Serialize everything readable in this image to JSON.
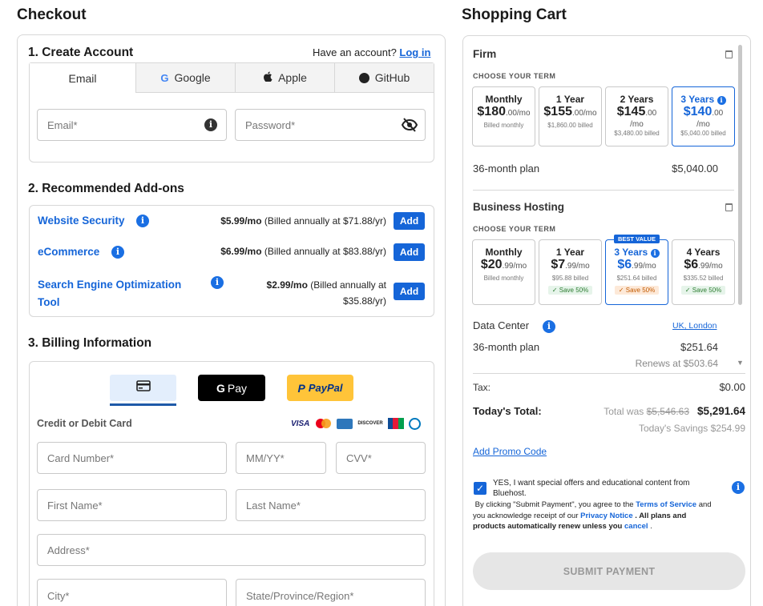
{
  "checkout": {
    "title": "Checkout",
    "create_account": {
      "title": "1. Create Account",
      "have_account_text": "Have an account?",
      "login_link": "Log in",
      "tabs": [
        "Email",
        "Google",
        "Apple",
        "GitHub"
      ],
      "email_placeholder": "Email*",
      "password_placeholder": "Password*"
    },
    "addons": {
      "title": "2. Recommended Add-ons",
      "items": [
        {
          "name": "Website Security",
          "price": "$5.99/mo",
          "billed": "(Billed annually at $71.88/yr)",
          "button": "Add"
        },
        {
          "name": "eCommerce",
          "price": "$6.99/mo",
          "billed": "(Billed annually at $83.88/yr)",
          "button": "Add"
        },
        {
          "name_line1": "Search Engine Optimization",
          "name_line2": "Tool",
          "price": "$2.99/mo",
          "billed_line1": "(Billed annually at",
          "billed_line2": "$35.88/yr)",
          "button": "Add"
        }
      ]
    },
    "billing": {
      "title": "3. Billing Information",
      "methods": {
        "card_icon": "credit-card-icon",
        "gpay": "Pay",
        "paypal": "PayPal"
      },
      "card_label": "Credit or Debit Card",
      "card_brands": [
        "VISA",
        "mastercard",
        "AMEX",
        "DISCOVER",
        "JCB",
        "diners"
      ],
      "placeholders": {
        "card_number": "Card Number*",
        "expiry": "MM/YY*",
        "cvv": "CVV*",
        "first_name": "First Name*",
        "last_name": "Last Name*",
        "address": "Address*",
        "city": "City*",
        "state": "State/Province/Region*"
      }
    }
  },
  "cart": {
    "title": "Shopping Cart",
    "firm": {
      "name": "Firm",
      "choose_term": "CHOOSE YOUR TERM",
      "terms": [
        {
          "name": "Monthly",
          "price": "$180",
          "cents": ".00/mo",
          "sub": "Billed monthly"
        },
        {
          "name": "1 Year",
          "price": "$155",
          "cents": ".00/mo",
          "sub": "$1,860.00 billed"
        },
        {
          "name": "2 Years",
          "price": "$145",
          "cents": ".00",
          "per": "/mo",
          "sub": "$3,480.00 billed"
        },
        {
          "name": "3 Years",
          "price": "$140",
          "cents": ".00",
          "per": "/mo",
          "sub": "$5,040.00 billed"
        }
      ],
      "plan_label": "36-month plan",
      "plan_price": "$5,040.00"
    },
    "business": {
      "name": "Business Hosting",
      "choose_term": "CHOOSE YOUR TERM",
      "best_value": "BEST VALUE",
      "terms": [
        {
          "name": "Monthly",
          "price": "$20",
          "cents": ".99/mo",
          "sub": "Billed monthly"
        },
        {
          "name": "1 Year",
          "price": "$7",
          "cents": ".99/mo",
          "sub": "$95.88 billed",
          "save": "Save 50%"
        },
        {
          "name": "3 Years",
          "price": "$6",
          "cents": ".99/mo",
          "sub": "$251.64 billed",
          "save": "Save 50%"
        },
        {
          "name": "4 Years",
          "price": "$6",
          "cents": ".99/mo",
          "sub": "$335.52 billed",
          "save": "Save 50%"
        }
      ],
      "data_center_label": "Data Center",
      "data_center_value": "UK, London",
      "plan_label": "36-month plan",
      "plan_price": "$251.64",
      "renews": "Renews at $503.64"
    },
    "tax_label": "Tax:",
    "tax_value": "$0.00",
    "total_label": "Today's Total:",
    "total_was_label": "Total was",
    "total_was_value": "$5,546.63",
    "total_value": "$5,291.64",
    "savings": "Today's Savings $254.99",
    "promo_link": "Add Promo Code",
    "offers_text_line1": "YES, I want special offers and educational content from",
    "offers_text_line2": "Bluehost.",
    "terms_text": {
      "p1": "By clicking \"Submit Payment\", you agree to the ",
      "tos": "Terms of Service",
      "p2": " and",
      "p3": "you acknowledge receipt of our ",
      "privacy": "Privacy Notice",
      "p4": " .  All plans and",
      "p5": "products automatically renew unless you ",
      "cancel": "cancel",
      "p6": " ."
    },
    "submit_label": "SUBMIT PAYMENT"
  },
  "colors": {
    "accent": "#1565d8",
    "paypal_yellow": "#ffc439",
    "gpay_black": "#000000"
  }
}
